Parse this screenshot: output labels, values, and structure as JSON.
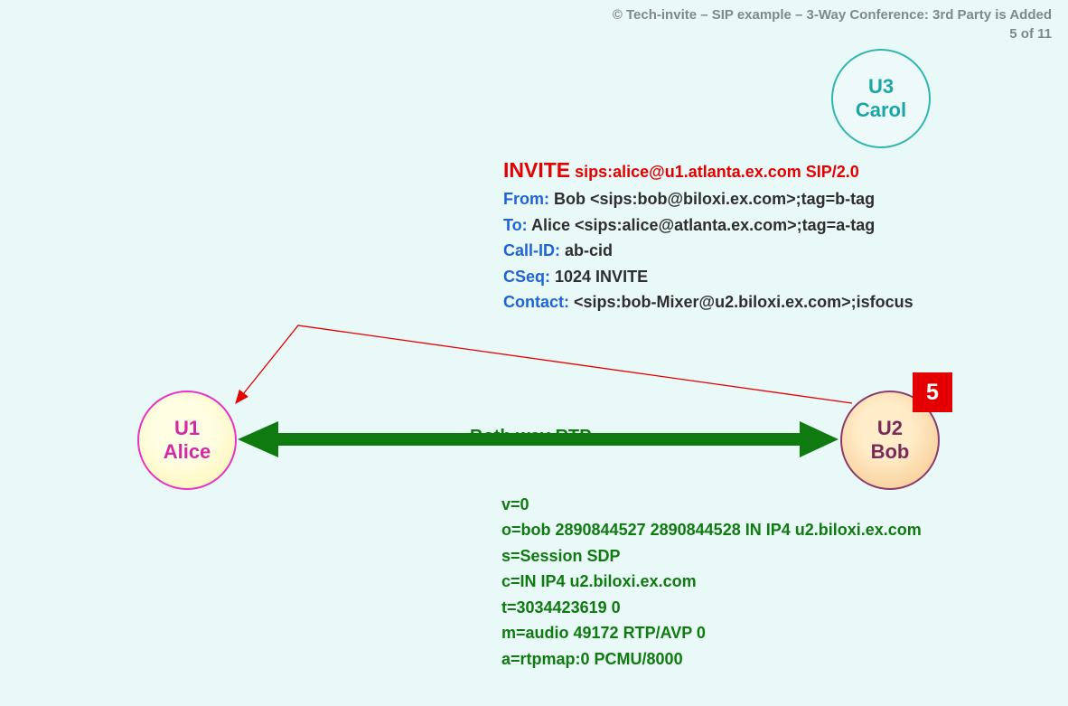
{
  "header": {
    "title": "© Tech-invite – SIP example – 3-Way Conference: 3rd Party is Added",
    "page": "5 of 11"
  },
  "nodes": {
    "u1": {
      "id": "U1",
      "name": "Alice"
    },
    "u2": {
      "id": "U2",
      "name": "Bob"
    },
    "u3": {
      "id": "U3",
      "name": "Carol"
    }
  },
  "step_badge": "5",
  "sip": {
    "method": "INVITE",
    "request_rest": " sips:alice@u1.atlanta.ex.com SIP/2.0",
    "headers": [
      {
        "k": "From:",
        "v": " Bob <sips:bob@biloxi.ex.com>;tag=b-tag"
      },
      {
        "k": "To:",
        "v": " Alice <sips:alice@atlanta.ex.com>;tag=a-tag"
      },
      {
        "k": "Call-ID:",
        "v": " ab-cid"
      },
      {
        "k": "CSeq:",
        "v": " 1024 INVITE"
      },
      {
        "k": "Contact:",
        "v": " <sips:bob-Mixer@u2.biloxi.ex.com>;isfocus"
      }
    ]
  },
  "rtp_label": "Both way RTP",
  "sdp_lines": [
    "v=0",
    "o=bob  2890844527  2890844528  IN  IP4  u2.biloxi.ex.com",
    "s=Session SDP",
    "c=IN  IP4  u2.biloxi.ex.com",
    "t=3034423619  0",
    "m=audio  49172  RTP/AVP  0",
    "a=rtpmap:0  PCMU/8000"
  ]
}
